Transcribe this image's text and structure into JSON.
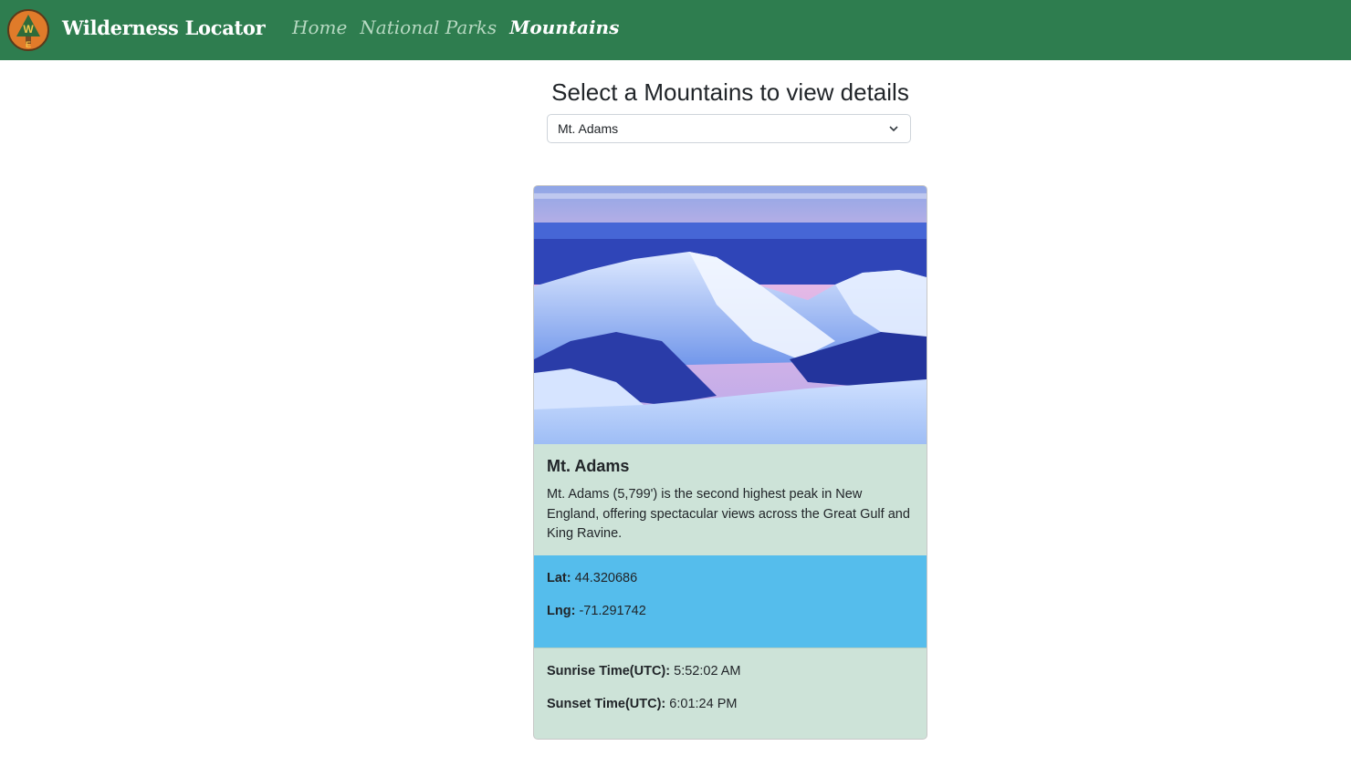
{
  "navbar": {
    "brand": "Wilderness Locator",
    "logo_letters": {
      "top": "W",
      "bottom": "E"
    },
    "links": [
      {
        "label": "Home",
        "active": false
      },
      {
        "label": "National Parks",
        "active": false
      },
      {
        "label": "Mountains",
        "active": true
      }
    ]
  },
  "selector": {
    "title": "Select a Mountains to view details",
    "selected": "Mt. Adams"
  },
  "card": {
    "title": "Mt. Adams",
    "description": "Mt. Adams (5,799') is the second highest peak in New England, offering spectacular views across the Great Gulf and King Ravine.",
    "lat_label": "Lat:",
    "lat_value": "44.320686",
    "lng_label": "Lng:",
    "lng_value": "-71.291742",
    "sunrise_label": "Sunrise Time(UTC):",
    "sunrise_value": "5:52:02 AM",
    "sunset_label": "Sunset Time(UTC):",
    "sunset_value": "6:01:24 PM"
  },
  "colors": {
    "navbar": "#2e7d4f",
    "card_body": "#cde3d8",
    "coords_band": "#55bdec"
  }
}
